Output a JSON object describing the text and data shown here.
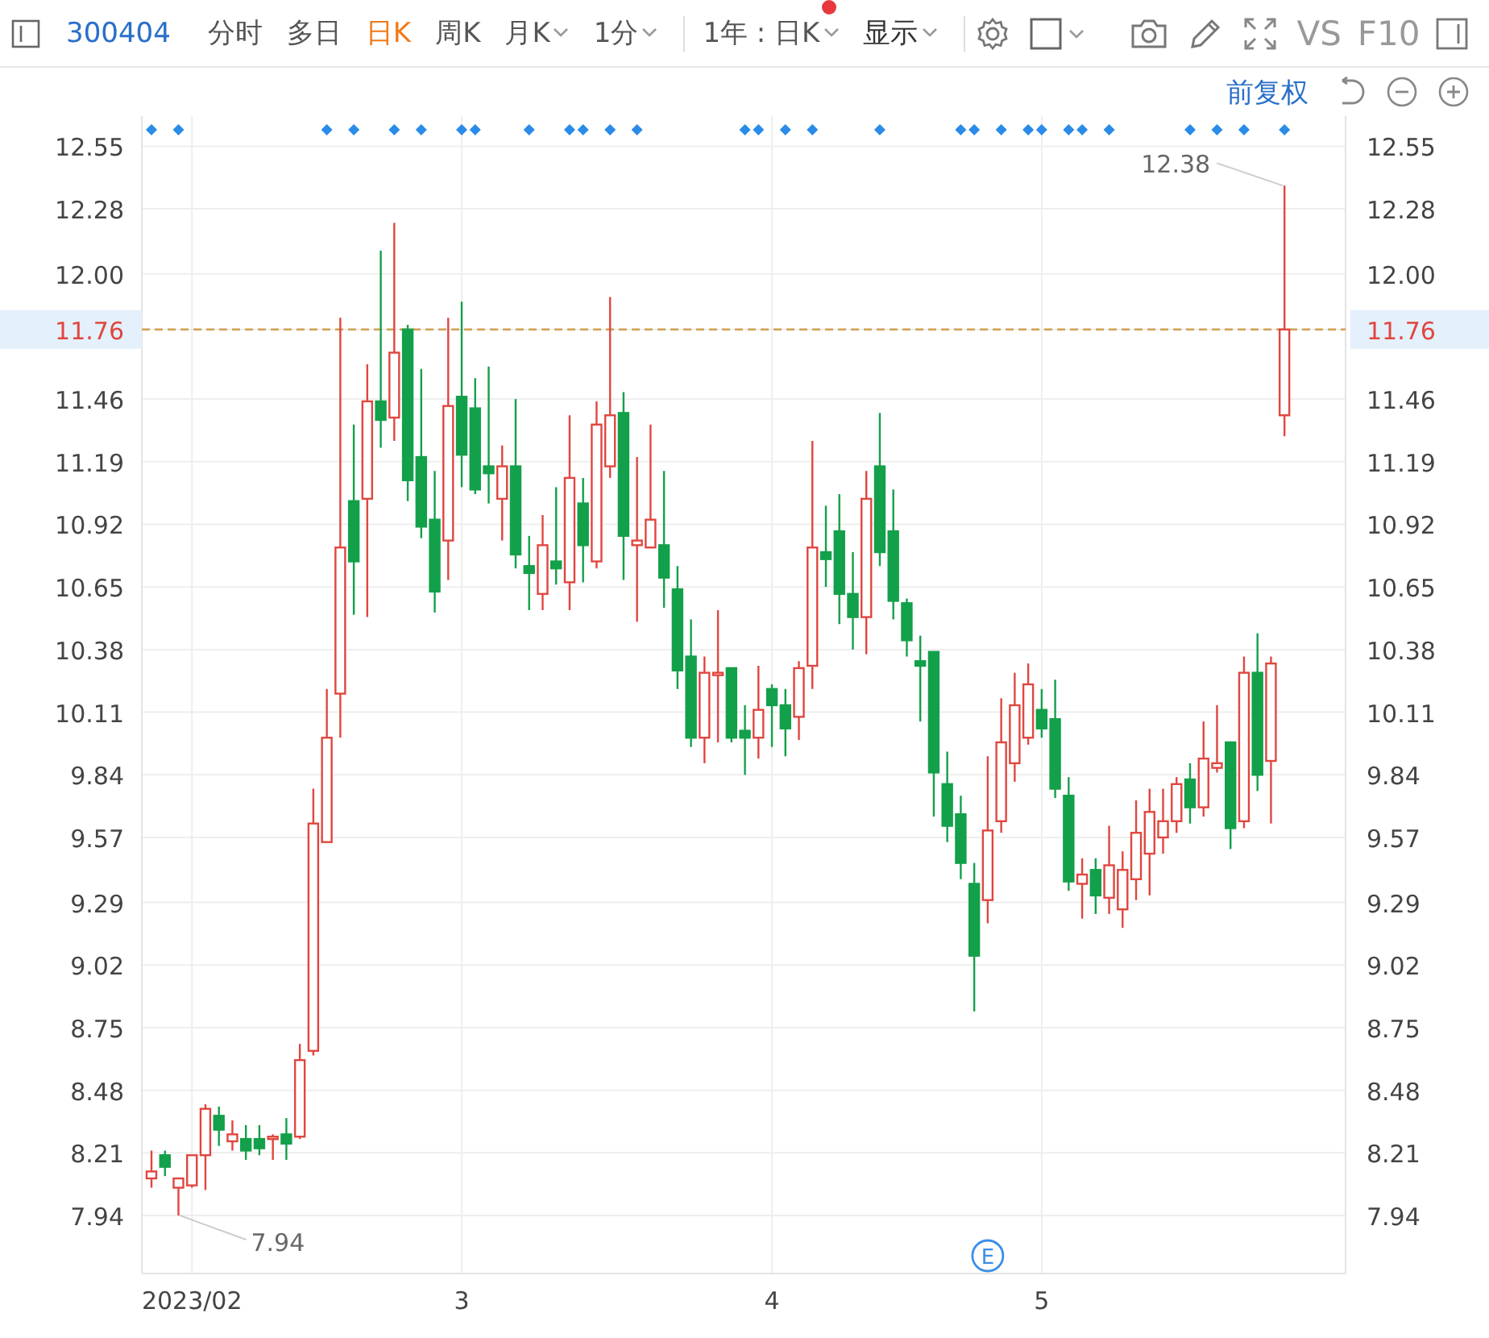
{
  "toolbar": {
    "code": "300404",
    "tabs": [
      {
        "label": "分时",
        "selected": false,
        "dropdown": false
      },
      {
        "label": "多日",
        "selected": false,
        "dropdown": false
      },
      {
        "label": "日K",
        "selected": true,
        "dropdown": false
      },
      {
        "label": "周K",
        "selected": false,
        "dropdown": false
      },
      {
        "label": "月K",
        "selected": false,
        "dropdown": true
      },
      {
        "label": "1分",
        "selected": false,
        "dropdown": true
      }
    ],
    "range_select": {
      "label": "1年 : 日K",
      "alert_dot": true
    },
    "display_select": {
      "label": "显示"
    },
    "compare_label": "VS",
    "f10_label": "F10"
  },
  "chart": {
    "adjust_mode": "前复权",
    "right_axis": [
      {
        "label": "12.55"
      },
      {
        "label": "12.28"
      },
      {
        "label": "12.00"
      },
      {
        "label": "11.76"
      },
      {
        "label": "11.46"
      },
      {
        "label": "11.19"
      },
      {
        "label": "10.92"
      },
      {
        "label": "10.65"
      },
      {
        "label": "10.38"
      },
      {
        "label": "10.11"
      },
      {
        "label": "9.84"
      },
      {
        "label": "9.57"
      },
      {
        "label": "9.29"
      },
      {
        "label": "9.02"
      },
      {
        "label": "8.75"
      },
      {
        "label": "8.48"
      },
      {
        "label": "8.21"
      },
      {
        "label": "7.94"
      }
    ],
    "extreme_labels": [
      {
        "kind": "max",
        "label": "12.38"
      },
      {
        "kind": "min",
        "label": "7.94"
      }
    ],
    "candle_events": [
      {
        "marked": true
      },
      {
        "marked": false
      },
      {
        "marked": true
      },
      {
        "marked": false
      },
      {
        "marked": false
      },
      {
        "marked": false
      },
      {
        "marked": false
      },
      {
        "marked": false
      },
      {
        "marked": false
      },
      {
        "marked": false
      },
      {
        "marked": false
      },
      {
        "marked": false
      },
      {
        "marked": false
      },
      {
        "marked": true
      },
      {
        "marked": false
      },
      {
        "marked": true
      },
      {
        "marked": false
      },
      {
        "marked": false
      },
      {
        "marked": true
      },
      {
        "marked": false
      },
      {
        "marked": true
      },
      {
        "marked": false
      },
      {
        "marked": false
      },
      {
        "marked": true
      },
      {
        "marked": true
      },
      {
        "marked": false
      },
      {
        "marked": false
      },
      {
        "marked": false
      },
      {
        "marked": true
      },
      {
        "marked": false
      },
      {
        "marked": false
      },
      {
        "marked": true
      },
      {
        "marked": true
      },
      {
        "marked": false
      },
      {
        "marked": true
      },
      {
        "marked": false
      },
      {
        "marked": true
      },
      {
        "marked": false
      },
      {
        "marked": false
      },
      {
        "marked": false
      },
      {
        "marked": false
      },
      {
        "marked": false
      },
      {
        "marked": false
      },
      {
        "marked": false
      },
      {
        "marked": true
      },
      {
        "marked": true
      },
      {
        "marked": false
      },
      {
        "marked": true
      },
      {
        "marked": false
      },
      {
        "marked": true
      },
      {
        "marked": false
      },
      {
        "marked": false
      },
      {
        "marked": false
      },
      {
        "marked": false
      },
      {
        "marked": true
      },
      {
        "marked": false
      },
      {
        "marked": false
      },
      {
        "marked": false
      },
      {
        "marked": false
      },
      {
        "marked": false
      },
      {
        "marked": true
      },
      {
        "marked": true
      },
      {
        "marked": false,
        "badge": "E"
      },
      {
        "marked": true
      },
      {
        "marked": false
      },
      {
        "marked": true
      },
      {
        "marked": true
      },
      {
        "marked": false
      },
      {
        "marked": true
      },
      {
        "marked": true
      },
      {
        "marked": false
      },
      {
        "marked": true
      },
      {
        "marked": false
      },
      {
        "marked": false
      },
      {
        "marked": false
      },
      {
        "marked": false
      },
      {
        "marked": false
      },
      {
        "marked": true
      },
      {
        "marked": false
      },
      {
        "marked": true
      },
      {
        "marked": false
      },
      {
        "marked": true
      },
      {
        "marked": false
      },
      {
        "marked": false
      },
      {
        "marked": true
      }
    ],
    "chart_data": {
      "type": "candlestick",
      "ylim": [
        7.69,
        12.68
      ],
      "grid": true,
      "ref_lines": [
        {
          "axis": "y",
          "value": 11.76
        }
      ],
      "categories": [
        null,
        null,
        null,
        "2023/02",
        null,
        null,
        null,
        null,
        null,
        null,
        null,
        null,
        null,
        null,
        null,
        null,
        null,
        null,
        null,
        null,
        null,
        null,
        null,
        "3",
        null,
        null,
        null,
        null,
        null,
        null,
        null,
        null,
        null,
        null,
        null,
        null,
        null,
        null,
        null,
        null,
        null,
        null,
        null,
        null,
        null,
        null,
        "4",
        null,
        null,
        null,
        null,
        null,
        null,
        null,
        null,
        null,
        null,
        null,
        null,
        null,
        null,
        null,
        null,
        null,
        null,
        null,
        "5",
        null,
        null,
        null,
        null,
        null,
        null,
        null,
        null,
        null,
        null,
        null,
        null,
        null,
        null,
        null,
        null,
        null,
        null
      ],
      "yticks": [
        {
          "value": 12.55,
          "label": "12.55"
        },
        {
          "value": 12.28,
          "label": "12.28"
        },
        {
          "value": 12.0,
          "label": "12.00"
        },
        {
          "value": 11.76,
          "label": "11.76"
        },
        {
          "value": 11.46,
          "label": "11.46"
        },
        {
          "value": 11.19,
          "label": "11.19"
        },
        {
          "value": 10.92,
          "label": "10.92"
        },
        {
          "value": 10.65,
          "label": "10.65"
        },
        {
          "value": 10.38,
          "label": "10.38"
        },
        {
          "value": 10.11,
          "label": "10.11"
        },
        {
          "value": 9.84,
          "label": "9.84"
        },
        {
          "value": 9.57,
          "label": "9.57"
        },
        {
          "value": 9.29,
          "label": "9.29"
        },
        {
          "value": 9.02,
          "label": "9.02"
        },
        {
          "value": 8.75,
          "label": "8.75"
        },
        {
          "value": 8.48,
          "label": "8.48"
        },
        {
          "value": 8.21,
          "label": "8.21"
        },
        {
          "value": 7.94,
          "label": "7.94"
        }
      ],
      "ohlc": [
        [
          8.1,
          8.22,
          8.06,
          8.13
        ],
        [
          8.2,
          8.22,
          8.11,
          8.15
        ],
        [
          8.06,
          8.1,
          7.94,
          8.1
        ],
        [
          8.07,
          8.2,
          8.06,
          8.2
        ],
        [
          8.2,
          8.42,
          8.05,
          8.4
        ],
        [
          8.37,
          8.41,
          8.24,
          8.31
        ],
        [
          8.26,
          8.35,
          8.22,
          8.29
        ],
        [
          8.27,
          8.33,
          8.18,
          8.22
        ],
        [
          8.27,
          8.33,
          8.2,
          8.23
        ],
        [
          8.27,
          8.29,
          8.18,
          8.28
        ],
        [
          8.29,
          8.36,
          8.18,
          8.25
        ],
        [
          8.28,
          8.68,
          8.27,
          8.61
        ],
        [
          8.65,
          9.78,
          8.63,
          9.63
        ],
        [
          9.55,
          10.21,
          9.55,
          10.0
        ],
        [
          10.19,
          11.81,
          10.0,
          10.82
        ],
        [
          11.02,
          11.35,
          10.53,
          10.76
        ],
        [
          11.03,
          11.61,
          10.52,
          11.45
        ],
        [
          11.45,
          12.1,
          11.25,
          11.37
        ],
        [
          11.38,
          12.22,
          11.28,
          11.66
        ],
        [
          11.76,
          11.78,
          11.02,
          11.11
        ],
        [
          11.21,
          11.59,
          10.86,
          10.91
        ],
        [
          10.94,
          11.15,
          10.54,
          10.63
        ],
        [
          10.85,
          11.81,
          10.68,
          11.43
        ],
        [
          11.47,
          11.88,
          11.08,
          11.22
        ],
        [
          11.42,
          11.55,
          11.05,
          11.07
        ],
        [
          11.17,
          11.6,
          11.01,
          11.14
        ],
        [
          11.03,
          11.26,
          10.85,
          11.17
        ],
        [
          11.17,
          11.46,
          10.73,
          10.79
        ],
        [
          10.74,
          10.87,
          10.55,
          10.71
        ],
        [
          10.62,
          10.96,
          10.55,
          10.83
        ],
        [
          10.76,
          11.08,
          10.66,
          10.73
        ],
        [
          10.67,
          11.39,
          10.55,
          11.12
        ],
        [
          11.01,
          11.12,
          10.67,
          10.83
        ],
        [
          10.76,
          11.45,
          10.73,
          11.35
        ],
        [
          11.17,
          11.9,
          11.12,
          11.39
        ],
        [
          11.4,
          11.49,
          10.68,
          10.87
        ],
        [
          10.83,
          11.21,
          10.5,
          10.85
        ],
        [
          10.82,
          11.35,
          10.82,
          10.94
        ],
        [
          10.83,
          11.15,
          10.56,
          10.69
        ],
        [
          10.64,
          10.74,
          10.21,
          10.29
        ],
        [
          10.35,
          10.51,
          9.96,
          10.0
        ],
        [
          10.0,
          10.35,
          9.89,
          10.28
        ],
        [
          10.27,
          10.55,
          9.98,
          10.28
        ],
        [
          10.3,
          10.3,
          9.98,
          10.0
        ],
        [
          10.03,
          10.14,
          9.84,
          10.0
        ],
        [
          10.0,
          10.31,
          9.91,
          10.12
        ],
        [
          10.21,
          10.23,
          9.96,
          10.14
        ],
        [
          10.14,
          10.21,
          9.92,
          10.04
        ],
        [
          10.09,
          10.33,
          9.99,
          10.3
        ],
        [
          10.31,
          11.28,
          10.21,
          10.82
        ],
        [
          10.8,
          11.0,
          10.65,
          10.77
        ],
        [
          10.89,
          11.05,
          10.49,
          10.62
        ],
        [
          10.62,
          10.8,
          10.38,
          10.52
        ],
        [
          10.52,
          11.15,
          10.36,
          11.03
        ],
        [
          11.17,
          11.4,
          10.74,
          10.8
        ],
        [
          10.89,
          11.07,
          10.51,
          10.59
        ],
        [
          10.58,
          10.6,
          10.35,
          10.42
        ],
        [
          10.33,
          10.44,
          10.07,
          10.31
        ],
        [
          10.37,
          10.37,
          9.66,
          9.85
        ],
        [
          9.8,
          9.94,
          9.55,
          9.62
        ],
        [
          9.67,
          9.75,
          9.39,
          9.46
        ],
        [
          9.37,
          9.46,
          8.82,
          9.06
        ],
        [
          9.3,
          9.92,
          9.2,
          9.6
        ],
        [
          9.64,
          10.17,
          9.59,
          9.98
        ],
        [
          9.89,
          10.28,
          9.81,
          10.14
        ],
        [
          10.0,
          10.32,
          9.97,
          10.23
        ],
        [
          10.12,
          10.21,
          10.0,
          10.04
        ],
        [
          10.08,
          10.25,
          9.74,
          9.78
        ],
        [
          9.75,
          9.83,
          9.34,
          9.38
        ],
        [
          9.37,
          9.48,
          9.22,
          9.41
        ],
        [
          9.43,
          9.48,
          9.24,
          9.32
        ],
        [
          9.31,
          9.62,
          9.24,
          9.45
        ],
        [
          9.26,
          9.51,
          9.18,
          9.43
        ],
        [
          9.39,
          9.73,
          9.3,
          9.59
        ],
        [
          9.5,
          9.78,
          9.32,
          9.68
        ],
        [
          9.57,
          9.78,
          9.5,
          9.64
        ],
        [
          9.64,
          9.83,
          9.59,
          9.8
        ],
        [
          9.82,
          9.89,
          9.63,
          9.7
        ],
        [
          9.7,
          10.07,
          9.66,
          9.91
        ],
        [
          9.87,
          10.14,
          9.85,
          9.89
        ],
        [
          9.98,
          9.98,
          9.52,
          9.61
        ],
        [
          9.64,
          10.35,
          9.61,
          10.28
        ],
        [
          10.28,
          10.45,
          9.77,
          9.84
        ],
        [
          9.9,
          10.35,
          9.63,
          10.32
        ],
        [
          11.39,
          12.38,
          11.3,
          11.76
        ]
      ]
    }
  }
}
